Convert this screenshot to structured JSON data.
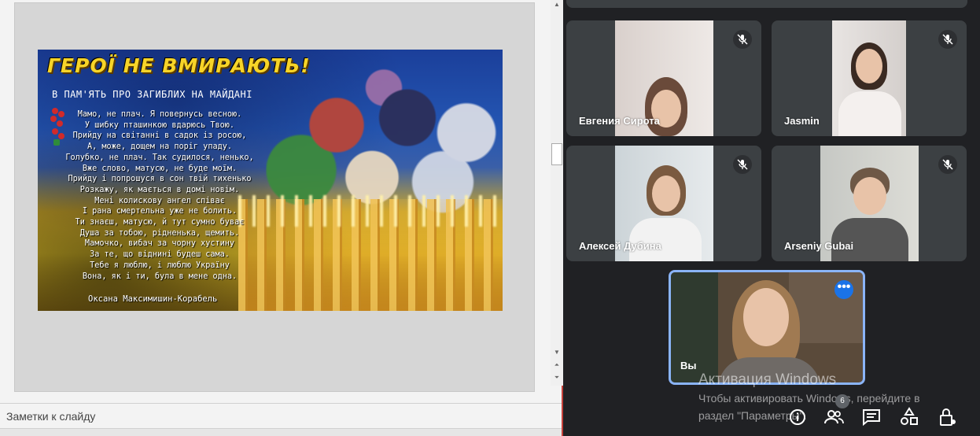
{
  "presentation": {
    "notes_placeholder": "Заметки к слайду",
    "slide": {
      "title": "ГЕРОЇ НЕ ВМИРАЮТЬ!",
      "subtitle": "В ПАМ'ЯТЬ ПРО ЗАГИБЛИХ НА МАЙДАНІ",
      "poem_lines": [
        "Мамо, не плач. Я повернусь весною.",
        "У шибку пташинкою вдарюсь Твою.",
        "Прийду на світанні в садок із росою,",
        "А, може, дощем на поріг упаду.",
        "Голубко, не плач. Так судилося, ненько,",
        "Вже слово, матусю, не буде моїм.",
        "Прийду і попрошуся в сон твій тихенько",
        "Розкажу, як мається в домі новім.",
        "Мені колискову ангел співає",
        "І рана смертельна уже не болить.",
        "Ти знаєш, матусю, й тут сумно буває",
        "Душа за тобою, рідненька, щемить.",
        "Мамочко, вибач за чорну хустину",
        "За те, що віднині будеш сама.",
        "Тебе я люблю, і люблю Україну",
        "Вона, як і ти, була в мене одна."
      ],
      "author": "Оксана Максимишин-Корабель"
    }
  },
  "meet": {
    "participants": [
      {
        "name": "Евгения Сирота",
        "mic": "muted"
      },
      {
        "name": "Jasmin",
        "mic": "muted"
      },
      {
        "name": "Алексей Дубина",
        "mic": "muted"
      },
      {
        "name": "Arseniy Gubai",
        "mic": "muted"
      }
    ],
    "self": {
      "name": "Вы",
      "more_label": "•••"
    },
    "participants_count": "6",
    "watermark": {
      "title": "Активация Windows",
      "line1": "Чтобы активировать Windows, перейдите в",
      "line2": "раздел \"Параметры\"."
    },
    "controls": [
      "info-icon",
      "people-icon",
      "chat-icon",
      "activities-icon",
      "host-controls-icon"
    ],
    "colors": {
      "background": "#202124",
      "tile": "#3c4043",
      "accent": "#8ab4f8",
      "more_button": "#1a73e8"
    }
  }
}
